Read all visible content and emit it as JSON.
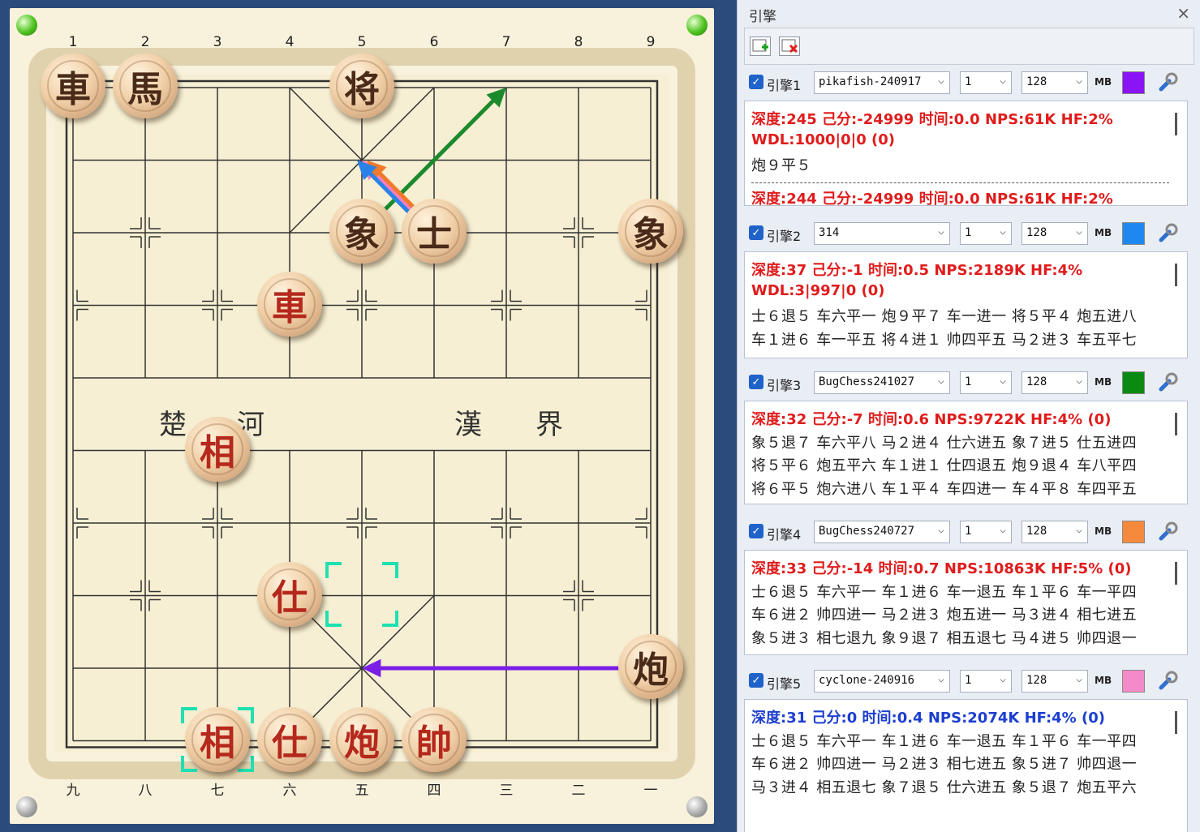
{
  "board": {
    "file_labels_top": [
      "1",
      "2",
      "3",
      "4",
      "5",
      "6",
      "7",
      "8",
      "9"
    ],
    "file_labels_bottom": [
      "九",
      "八",
      "七",
      "六",
      "五",
      "四",
      "三",
      "二",
      "一"
    ],
    "river": [
      "楚",
      "河",
      "漢",
      "界"
    ],
    "pieces": [
      {
        "char": "車",
        "side": "black",
        "file": 1,
        "rank": 0
      },
      {
        "char": "馬",
        "side": "black",
        "file": 2,
        "rank": 0
      },
      {
        "char": "将",
        "side": "black",
        "file": 5,
        "rank": 0
      },
      {
        "char": "象",
        "side": "black",
        "file": 5,
        "rank": 2
      },
      {
        "char": "士",
        "side": "black",
        "file": 6,
        "rank": 2
      },
      {
        "char": "象",
        "side": "black",
        "file": 9,
        "rank": 2
      },
      {
        "char": "車",
        "side": "red",
        "file": 4,
        "rank": 3
      },
      {
        "char": "相",
        "side": "red",
        "file": 3,
        "rank": 5
      },
      {
        "char": "仕",
        "side": "red",
        "file": 4,
        "rank": 7
      },
      {
        "char": "炮",
        "side": "black",
        "file": 9,
        "rank": 8
      },
      {
        "char": "相",
        "side": "red",
        "file": 3,
        "rank": 9
      },
      {
        "char": "仕",
        "side": "red",
        "file": 4,
        "rank": 9
      },
      {
        "char": "炮",
        "side": "red",
        "file": 5,
        "rank": 9
      },
      {
        "char": "帥",
        "side": "red",
        "file": 6,
        "rank": 9
      }
    ],
    "arrows": [
      {
        "color": "#1b8a2c",
        "from": [
          5,
          2
        ],
        "to": [
          7,
          0
        ]
      },
      {
        "color": "#f37fc0",
        "from": [
          6,
          2
        ],
        "to": [
          5,
          1
        ]
      },
      {
        "color": "#f07a2a",
        "from": [
          6,
          2
        ],
        "to": [
          5,
          1
        ]
      },
      {
        "color": "#2b82e6",
        "from": [
          6,
          2
        ],
        "to": [
          5,
          1
        ]
      },
      {
        "color": "#7b1ee8",
        "from": [
          9,
          8
        ],
        "to": [
          5,
          8
        ]
      }
    ]
  },
  "panel": {
    "title": "引擎",
    "close": "×",
    "toolbar": {
      "add_icon": "add-engine-icon",
      "remove_icon": "remove-engine-icon"
    },
    "mb": "MB",
    "engines": [
      {
        "label": "引擎1",
        "name": "pikafish-240917",
        "threads": "1",
        "hash": "128",
        "color": "#8a14f5",
        "lines": [
          {
            "text": "深度:245  己分:-24999  时间:0.0  NPS:61K HF:2%",
            "style": "red"
          },
          {
            "text": "WDL:1000|0|0 (0)",
            "style": "red"
          },
          {
            "text": "炮９平５",
            "style": "pv"
          },
          {
            "text": "深度:244  己分:-24999  时间:0.0  NPS:61K HF:2%",
            "style": "red"
          }
        ]
      },
      {
        "label": "引擎2",
        "name": "314",
        "threads": "1",
        "hash": "128",
        "color": "#1e88f0",
        "lines": [
          {
            "text": "深度:37  己分:-1  时间:0.5  NPS:2189K HF:4%",
            "style": "red"
          },
          {
            "text": "WDL:3|997|0 (0)",
            "style": "red"
          },
          {
            "text": "士６退５ 车六平一 炮９平７ 车一进一 将５平４ 炮五进八",
            "style": "pv"
          },
          {
            "text": "车１进６ 车一平五 将４进１ 帅四平五 马２进３ 车五平七",
            "style": "pv"
          }
        ]
      },
      {
        "label": "引擎3",
        "name": "BugChess241027",
        "threads": "1",
        "hash": "128",
        "color": "#0b8a12",
        "lines": [
          {
            "text": "深度:32  己分:-7  时间:0.6  NPS:9722K HF:4% (0)",
            "style": "red"
          },
          {
            "text": "象５退７ 车六平八 马２进４ 仕六进五 象７进５ 仕五进四",
            "style": "pv"
          },
          {
            "text": "将５平６ 炮五平六 车１进１ 仕四退五 炮９退４ 车八平四",
            "style": "pv"
          },
          {
            "text": "将６平５ 炮六进八 车１平４ 车四进一 车４平８ 车四平五",
            "style": "pv"
          }
        ]
      },
      {
        "label": "引擎4",
        "name": "BugChess240727",
        "threads": "1",
        "hash": "128",
        "color": "#f58a3c",
        "lines": [
          {
            "text": "深度:33  己分:-14  时间:0.7  NPS:10863K HF:5% (0)",
            "style": "red"
          },
          {
            "text": "士６退５ 车六平一 车１进６ 车一退五 车１平６ 车一平四",
            "style": "pv"
          },
          {
            "text": "车６进２ 帅四进一 马２进３ 炮五进一 马３进４ 相七进五",
            "style": "pv"
          },
          {
            "text": "象５进３ 相七退九 象９退７ 相五退七 马４进５ 帅四退一",
            "style": "pv"
          }
        ]
      },
      {
        "label": "引擎5",
        "name": "cyclone-240916",
        "threads": "1",
        "hash": "128",
        "color": "#f58ac8",
        "lines": [
          {
            "text": "深度:31  己分:0  时间:0.4  NPS:2074K HF:4% (0)",
            "style": "blue"
          },
          {
            "text": "士６退５ 车六平一 车１进６ 车一退五 车１平６ 车一平四",
            "style": "pv"
          },
          {
            "text": "车６进２ 帅四进一 马２进３ 相七进五 象５进７ 帅四退一",
            "style": "pv"
          },
          {
            "text": "马３进４ 相五退七 象７退５ 仕六进五 象５退７ 炮五平六",
            "style": "pv"
          }
        ]
      }
    ]
  }
}
